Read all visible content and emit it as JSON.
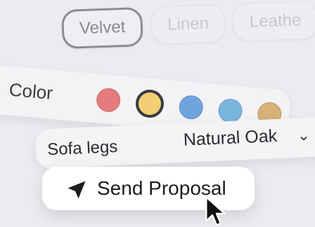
{
  "fabric": {
    "options": [
      {
        "label": "Velvet",
        "selected": true
      },
      {
        "label": "Linen",
        "selected": false
      },
      {
        "label": "Leathe",
        "selected": false
      }
    ]
  },
  "color": {
    "label": "Color",
    "swatches": [
      {
        "name": "red",
        "hex": "#e67b7d",
        "selected": false
      },
      {
        "name": "yellow",
        "hex": "#f2cf74",
        "selected": true
      },
      {
        "name": "blue",
        "hex": "#6fa4dd",
        "selected": false
      },
      {
        "name": "teal",
        "hex": "#7ab6dc",
        "selected": false
      },
      {
        "name": "tan",
        "hex": "#d6b178",
        "selected": false
      }
    ]
  },
  "legs": {
    "label": "Sofa legs",
    "value": "Natural Oak",
    "chevron_icon": "chevron-down-icon"
  },
  "action": {
    "label": "Send Proposal",
    "icon": "send-icon"
  },
  "cursor_icon": "pointer-cursor-icon"
}
